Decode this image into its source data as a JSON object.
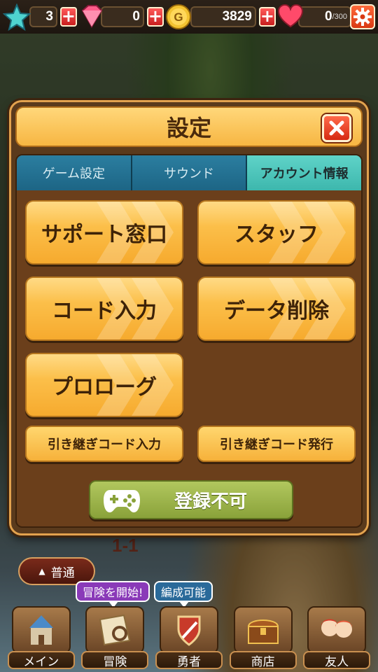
{
  "topbar": {
    "stars": "3",
    "gems": "0",
    "coins": "3829",
    "coin_symbol": "G",
    "hearts_current": "0",
    "hearts_max": "/300"
  },
  "dialog": {
    "title": "設定",
    "tabs": [
      {
        "label": "ゲーム設定",
        "active": false
      },
      {
        "label": "サウンド",
        "active": false
      },
      {
        "label": "アカウント情報",
        "active": true
      }
    ],
    "buttons": {
      "support": "サポート窓口",
      "staff": "スタッフ",
      "code_input": "コード入力",
      "data_delete": "データ削除",
      "prologue": "プロローグ",
      "transfer_code_input": "引き継ぎコード入力",
      "transfer_code_issue": "引き継ぎコード発行",
      "register": "登録不可"
    }
  },
  "bottom": {
    "stage": "1-1",
    "difficulty": "普通",
    "bubble_adventure": "冒険を開始!",
    "bubble_formation": "編成可能",
    "nav": [
      {
        "label": "メイン",
        "icon": "castle-icon"
      },
      {
        "label": "冒険",
        "icon": "map-icon"
      },
      {
        "label": "勇者",
        "icon": "sword-shield-icon"
      },
      {
        "label": "商店",
        "icon": "treasure-chest-icon"
      },
      {
        "label": "友人",
        "icon": "friends-icon"
      }
    ]
  },
  "colors": {
    "accent_orange": "#f6aa2e",
    "tab_active": "#3db7ad",
    "tab_inactive": "#1d6585",
    "register_green": "#8aa23a",
    "panel_brown": "#6b3f1b"
  }
}
